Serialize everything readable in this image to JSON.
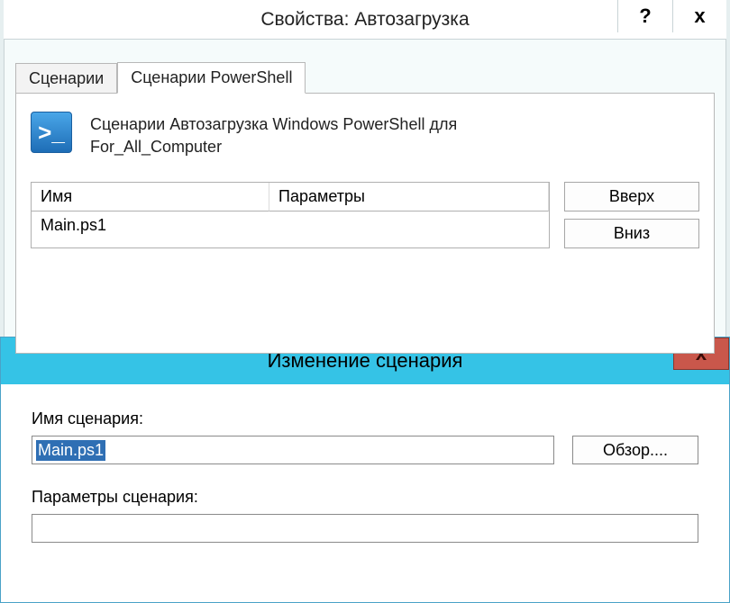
{
  "parent": {
    "title": "Свойства: Автозагрузка",
    "help_label": "?",
    "close_label": "x"
  },
  "tabs": {
    "scenarios": "Сценарии",
    "powershell": "Сценарии PowerShell"
  },
  "header": {
    "icon_glyph": ">_",
    "text_line1": "Сценарии Автозагрузка Windows PowerShell для",
    "text_line2": "For_All_Computer"
  },
  "table": {
    "col_name": "Имя",
    "col_params": "Параметры",
    "rows": [
      {
        "name": "Main.ps1",
        "params": ""
      }
    ]
  },
  "buttons": {
    "up": "Вверх",
    "down": "Вниз"
  },
  "modal": {
    "title": "Изменение сценария",
    "close_label": "x",
    "name_label": "Имя сценария:",
    "name_value": "Main.ps1",
    "browse": "Обзор....",
    "params_label": "Параметры сценария:",
    "params_value": ""
  }
}
